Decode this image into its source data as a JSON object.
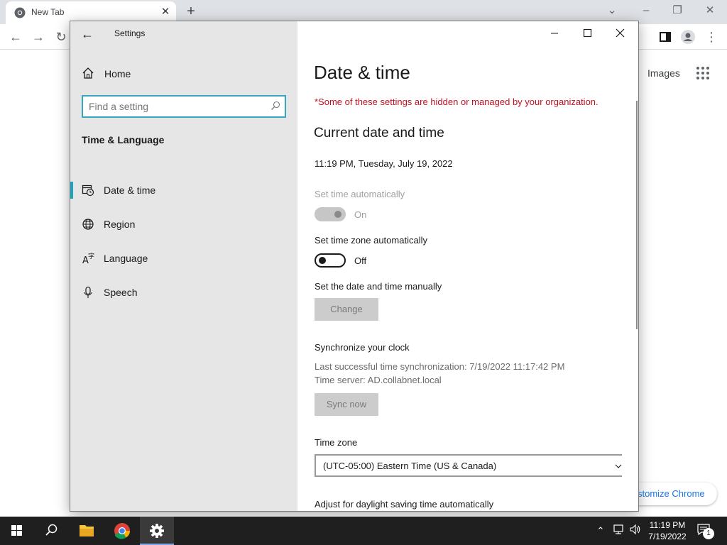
{
  "browser": {
    "tab_title": "New Tab",
    "tab_close": "✕",
    "new_tab": "+",
    "images_link": "Images",
    "customize_label": "stomize Chrome"
  },
  "settings": {
    "window_title": "Settings",
    "nav": {
      "home_label": "Home",
      "search_placeholder": "Find a setting",
      "section_heading": "Time & Language",
      "items": [
        {
          "label": "Date & time",
          "icon": "calendar-clock-icon",
          "active": true
        },
        {
          "label": "Region",
          "icon": "globe-icon",
          "active": false
        },
        {
          "label": "Language",
          "icon": "language-icon",
          "active": false
        },
        {
          "label": "Speech",
          "icon": "microphone-icon",
          "active": false
        }
      ]
    },
    "content": {
      "page_title": "Date & time",
      "managed_notice": "*Some of these settings are hidden or managed by your organization.",
      "current_heading": "Current date and time",
      "current_datetime": "11:19 PM, Tuesday, July 19, 2022",
      "set_time_auto_label": "Set time automatically",
      "set_time_auto_state": "On",
      "set_tz_auto_label": "Set time zone automatically",
      "set_tz_auto_state": "Off",
      "manual_label": "Set the date and time manually",
      "change_button": "Change",
      "sync_heading": "Synchronize your clock",
      "last_sync": "Last successful time synchronization: 7/19/2022 11:17:42 PM",
      "time_server": "Time server: AD.collabnet.local",
      "sync_button": "Sync now",
      "timezone_label": "Time zone",
      "timezone_value": "(UTC-05:00) Eastern Time (US & Canada)",
      "dst_label": "Adjust for daylight saving time automatically"
    }
  },
  "taskbar": {
    "clock_time": "11:19 PM",
    "clock_date": "7/19/2022",
    "notification_count": "1"
  },
  "colors": {
    "accent": "#1ea3bb",
    "search_border": "#36a9c0",
    "warning_text": "#c50f1f",
    "nav_bg": "#e6e6e6",
    "taskbar_bg": "#1f1f1f"
  }
}
